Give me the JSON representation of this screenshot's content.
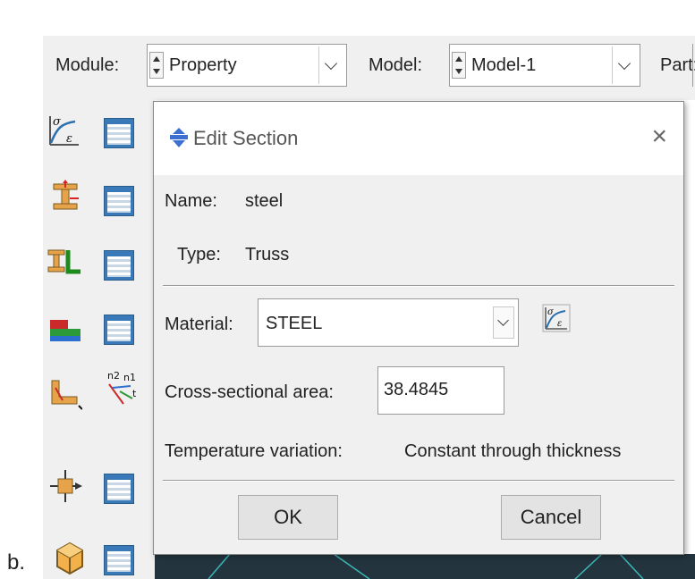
{
  "toolbar": {
    "module_label": "Module:",
    "module_value": "Property",
    "model_label": "Model:",
    "model_value": "Model-1",
    "part_label": "Part:"
  },
  "dialog": {
    "title": "Edit Section",
    "close_glyph": "×",
    "name_label": "Name:",
    "name_value": "steel",
    "type_label": "Type:",
    "type_value": "Truss",
    "material_label": "Material:",
    "material_value": "STEEL",
    "area_label": "Cross-sectional area:",
    "area_value": "38.4845",
    "temp_label": "Temperature variation:",
    "temp_value": "Constant through thickness",
    "ok_label": "OK",
    "cancel_label": "Cancel"
  },
  "caption": "b.",
  "colors": {
    "accent": "#2a6fb0",
    "dark_viewport": "#23343f"
  },
  "icons": [
    "stress-strain-icon",
    "section-icon",
    "beam-profile-icon",
    "composite-layup-icon",
    "orientation-icon",
    "offset-icon",
    "part-icon"
  ]
}
